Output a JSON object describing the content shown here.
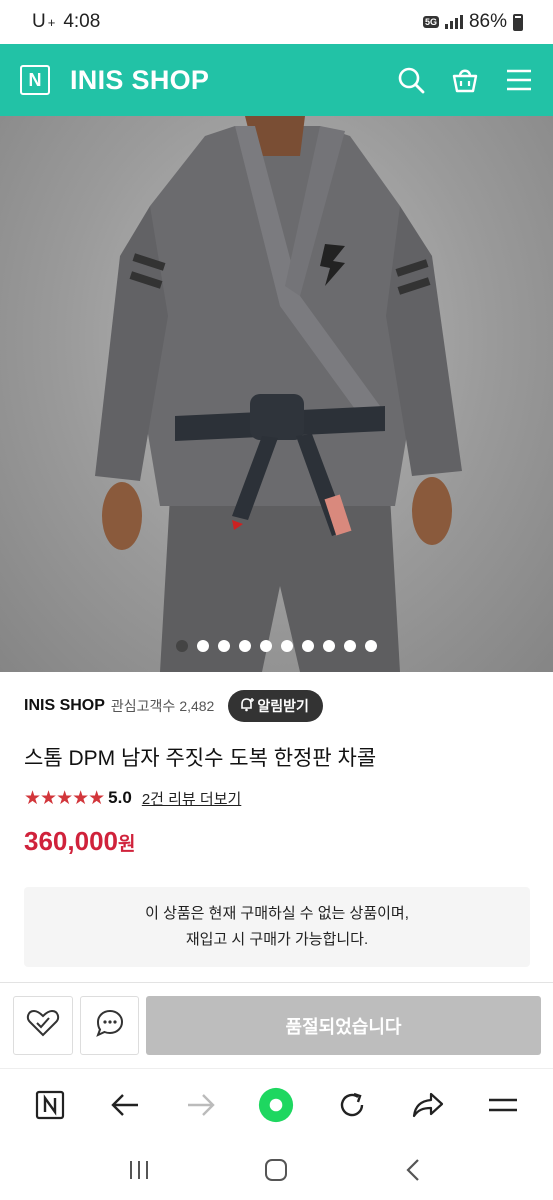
{
  "status_bar": {
    "carrier": "U",
    "carrier_sup": "+",
    "time": "4:08",
    "network": "5G",
    "battery": "86%"
  },
  "header": {
    "logo": "N",
    "title": "INIS SHOP",
    "icons": [
      "search-icon",
      "cart-icon",
      "menu-icon"
    ]
  },
  "gallery": {
    "slide_count": 10,
    "active_index": 0
  },
  "seller": {
    "name": "INIS SHOP",
    "followers_label": "관심고객수",
    "followers": "2,482",
    "notify_label": "알림받기"
  },
  "product": {
    "name": "스톰 DPM 남자 주짓수 도복 한정판 차콜",
    "stars": "★★★★★",
    "rating": "5.0",
    "review_link": "2건 리뷰 더보기",
    "price": "360,000",
    "currency": "원"
  },
  "notice": {
    "line1": "이 상품은 현재 구매하실 수 없는 상품이며,",
    "line2": "재입고 시 구매가 가능합니다."
  },
  "actions": {
    "soldout_label": "품절되었습니다"
  },
  "colors": {
    "brand": "#22c2a6",
    "price": "#d0223b",
    "star": "#d2363b",
    "browser_home": "#1ed760"
  }
}
